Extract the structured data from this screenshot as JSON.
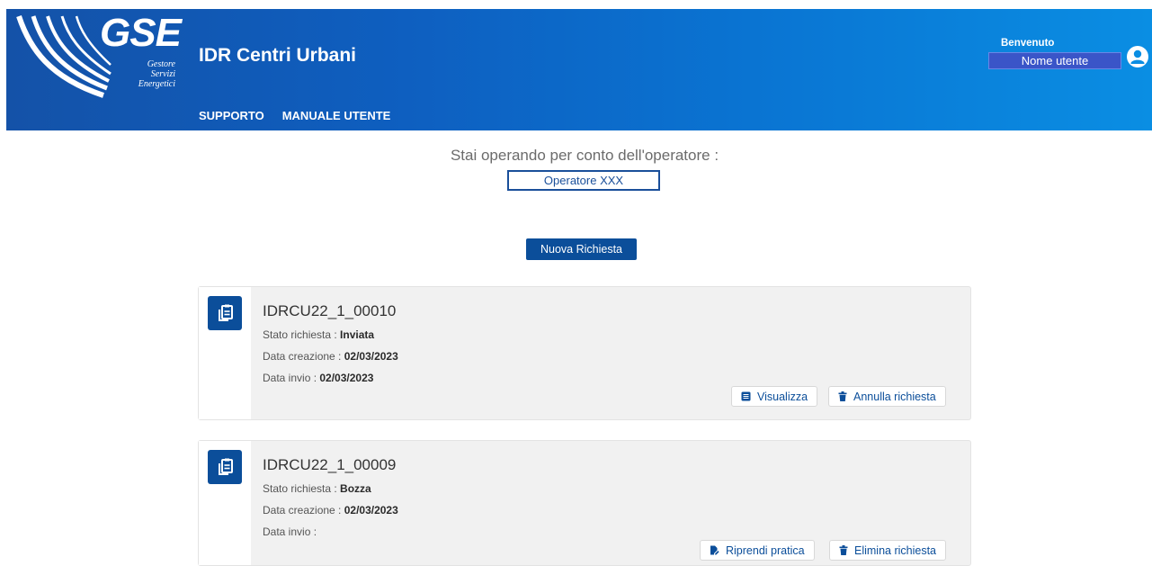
{
  "header": {
    "logo_text": "GSE",
    "logo_subtitle": [
      "Gestore",
      "Servizi",
      "Energetici"
    ],
    "app_title": "IDR Centri Urbani",
    "nav": [
      "SUPPORTO",
      "MANUALE UTENTE"
    ],
    "welcome_label": "Benvenuto",
    "username": "Nome utente"
  },
  "operator": {
    "label": "Stai operando per conto dell'operatore :",
    "name": "Operatore XXX"
  },
  "new_request_label": "Nuova Richiesta",
  "requests": [
    {
      "id": "IDRCU22_1_00010",
      "status_label": "Stato richiesta : ",
      "status": "Inviata",
      "created_label": "Data creazione : ",
      "created": "02/03/2023",
      "sent_label": "Data invio : ",
      "sent": "02/03/2023",
      "actions": [
        "Visualizza",
        "Annulla richiesta"
      ]
    },
    {
      "id": "IDRCU22_1_00009",
      "status_label": "Stato richiesta : ",
      "status": "Bozza",
      "created_label": "Data creazione : ",
      "created": "02/03/2023",
      "sent_label": "Data invio : ",
      "sent": "",
      "actions": [
        "Riprendi pratica",
        "Elimina richiesta"
      ]
    }
  ],
  "icons": {
    "request": "document-copy-icon",
    "view": "list-icon",
    "cancel": "trash-icon",
    "resume": "file-edit-icon",
    "delete": "trash-icon",
    "user": "user-circle-icon"
  },
  "colors": {
    "primary": "#0b4e9a",
    "header_start": "#1452a8",
    "header_end": "#0a8ee3",
    "card_bg": "#f1f1f1"
  }
}
